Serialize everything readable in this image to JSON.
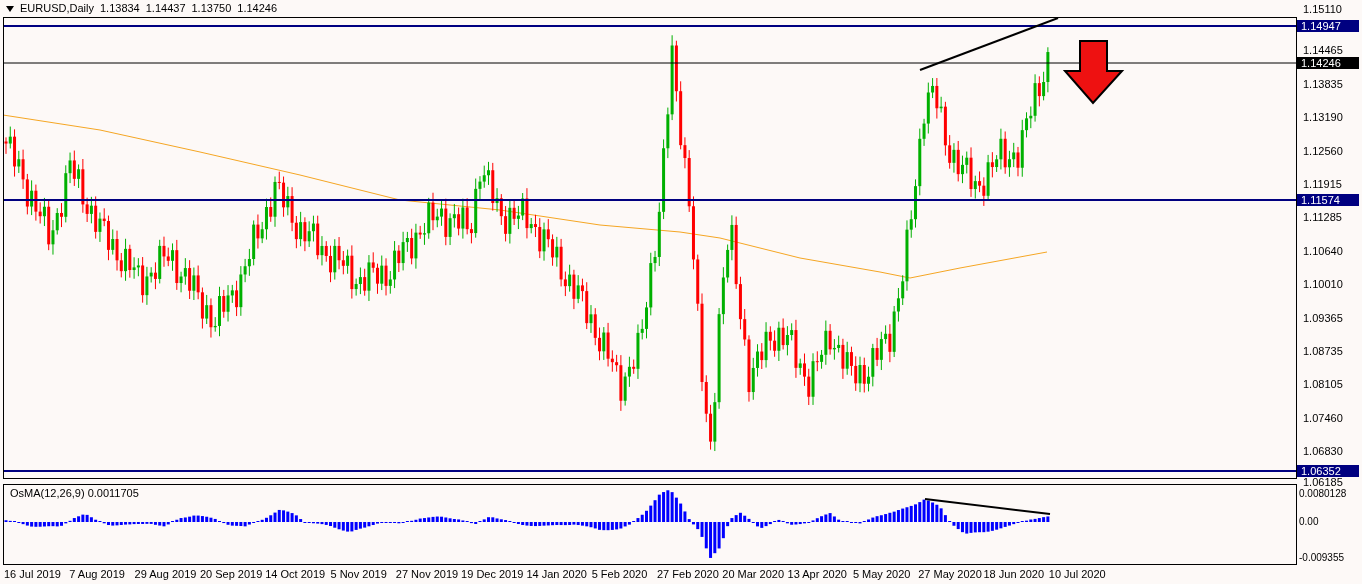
{
  "chart_header": {
    "symbol": "EURUSD,Daily",
    "ohlc": [
      "1.13834",
      "1.14437",
      "1.13750",
      "1.14246"
    ]
  },
  "price_axis": {
    "ticks": [
      "1.15110",
      "1.14465",
      "1.13835",
      "1.13190",
      "1.12560",
      "1.11915",
      "1.11285",
      "1.10640",
      "1.10010",
      "1.09365",
      "1.08735",
      "1.08105",
      "1.07460",
      "1.06830",
      "1.06185"
    ]
  },
  "price_levels": [
    {
      "label": "1.14947",
      "kind": "level"
    },
    {
      "label": "1.14246",
      "kind": "bid"
    },
    {
      "label": "1.11574",
      "kind": "level"
    },
    {
      "label": "1.06352",
      "kind": "level"
    }
  ],
  "indicator": {
    "label": "OsMA(12,26,9) 0.0011705",
    "axis_ticks": [
      "0.0080128",
      "0.00",
      "-0.009355"
    ]
  },
  "time_axis": {
    "ticks": [
      "16 Jul 2019",
      "7 Aug 2019",
      "29 Aug 2019",
      "20 Sep 2019",
      "14 Oct 2019",
      "5 Nov 2019",
      "27 Nov 2019",
      "19 Dec 2019",
      "14 Jan 2020",
      "5 Feb 2020",
      "27 Feb 2020",
      "20 Mar 2020",
      "13 Apr 2020",
      "5 May 2020",
      "27 May 2020",
      "18 Jun 2020",
      "10 Jul 2020"
    ]
  }
}
